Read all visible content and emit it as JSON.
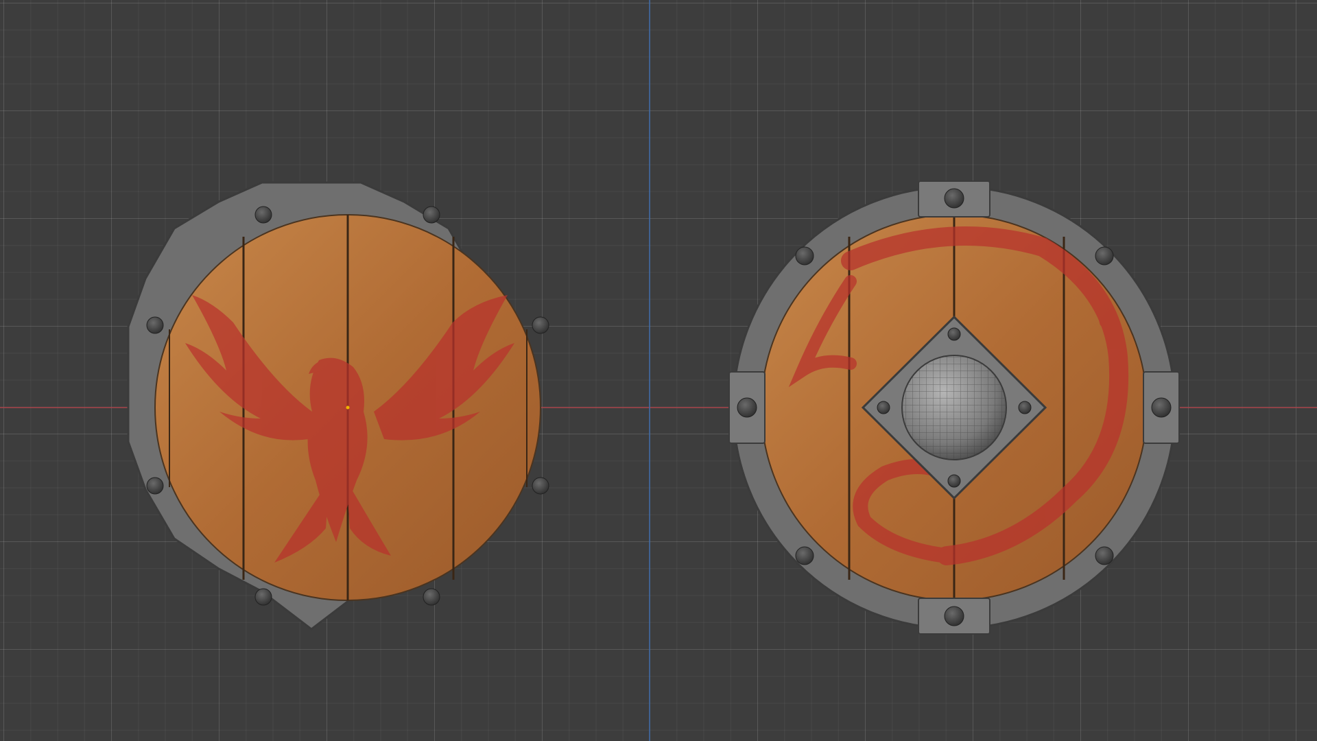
{
  "viewport": {
    "background_color": "#3d3d3d",
    "grid_color": "#4a4a4a",
    "x_axis_color": "#a8444a",
    "y_axis_color": "#3d6aa8"
  },
  "objects": [
    {
      "name": "shield-phoenix",
      "emblem": "phoenix",
      "rivets": 8,
      "boss": false,
      "paint_color": "#b8322c"
    },
    {
      "name": "shield-dragon",
      "emblem": "dragon",
      "rivets": 8,
      "boss": true,
      "paint_color": "#b8322c"
    }
  ],
  "materials": {
    "wood": "#b06a33",
    "wood_light": "#c8894a",
    "metal_rim": "#737373",
    "metal_dark": "#3f3f3f"
  }
}
